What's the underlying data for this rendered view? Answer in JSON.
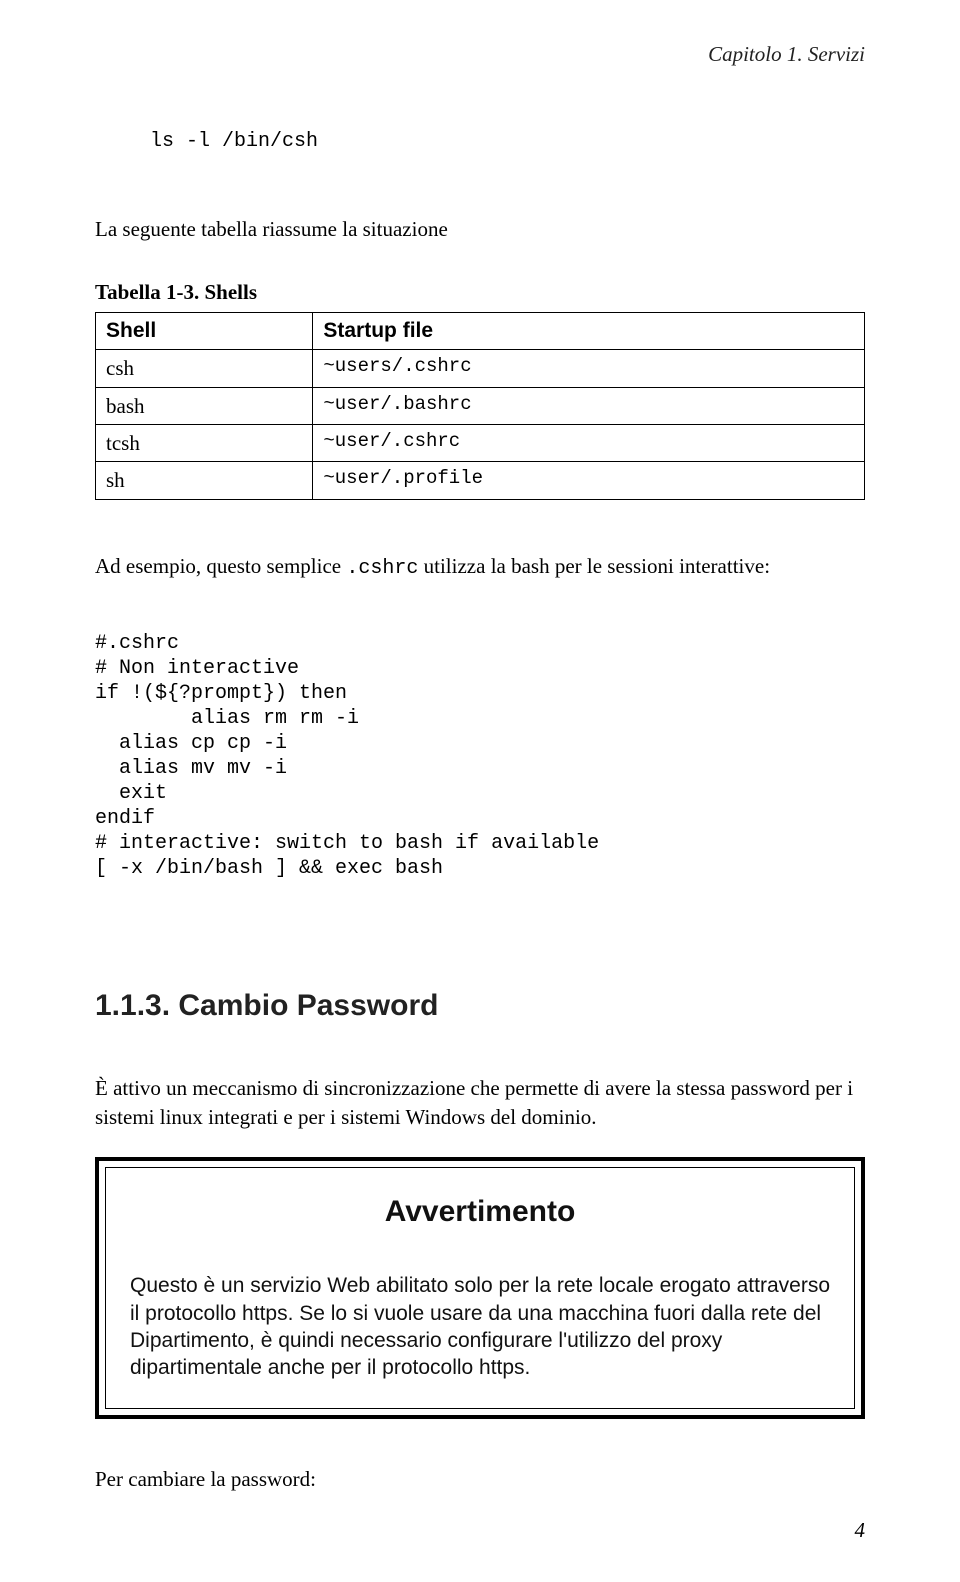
{
  "chapter_header": "Capitolo 1. Servizi",
  "cmd_ls": "ls -l /bin/csh",
  "intro_text": "La seguente tabella riassume la situazione",
  "table_caption": "Tabella 1-3. Shells",
  "table": {
    "headers": [
      "Shell",
      "Startup file"
    ],
    "rows": [
      [
        "csh",
        "~users/.cshrc"
      ],
      [
        "bash",
        "~user/.bashrc"
      ],
      [
        "tcsh",
        "~user/.cshrc"
      ],
      [
        "sh",
        "~user/.profile"
      ]
    ]
  },
  "example_pre": "Ad esempio, questo semplice ",
  "example_code": ".cshrc",
  "example_post": " utilizza la bash per le sessioni interattive:",
  "code_lines": [
    "#.cshrc",
    "# Non interactive",
    "if !(${?prompt}) then",
    "        alias rm rm -i",
    "  alias cp cp -i",
    "  alias mv mv -i",
    "  exit",
    "endif",
    "# interactive: switch to bash if available",
    "[ -x /bin/bash ] && exec bash"
  ],
  "section_heading": "1.1.3. Cambio Password",
  "section_body": "È attivo un meccanismo di sincronizzazione che permette di avere la stessa password per i sistemi linux integrati e per i sistemi Windows del dominio.",
  "warning": {
    "title": "Avvertimento",
    "body": "Questo è un servizio Web abilitato solo per la rete locale erogato attraverso il protocollo https. Se lo si vuole usare da una macchina fuori dalla rete del Dipartimento, è quindi necessario configurare l'utilizzo del proxy dipartimentale anche per il protocollo https."
  },
  "closing_text": "Per cambiare la password:",
  "page_number": "4"
}
